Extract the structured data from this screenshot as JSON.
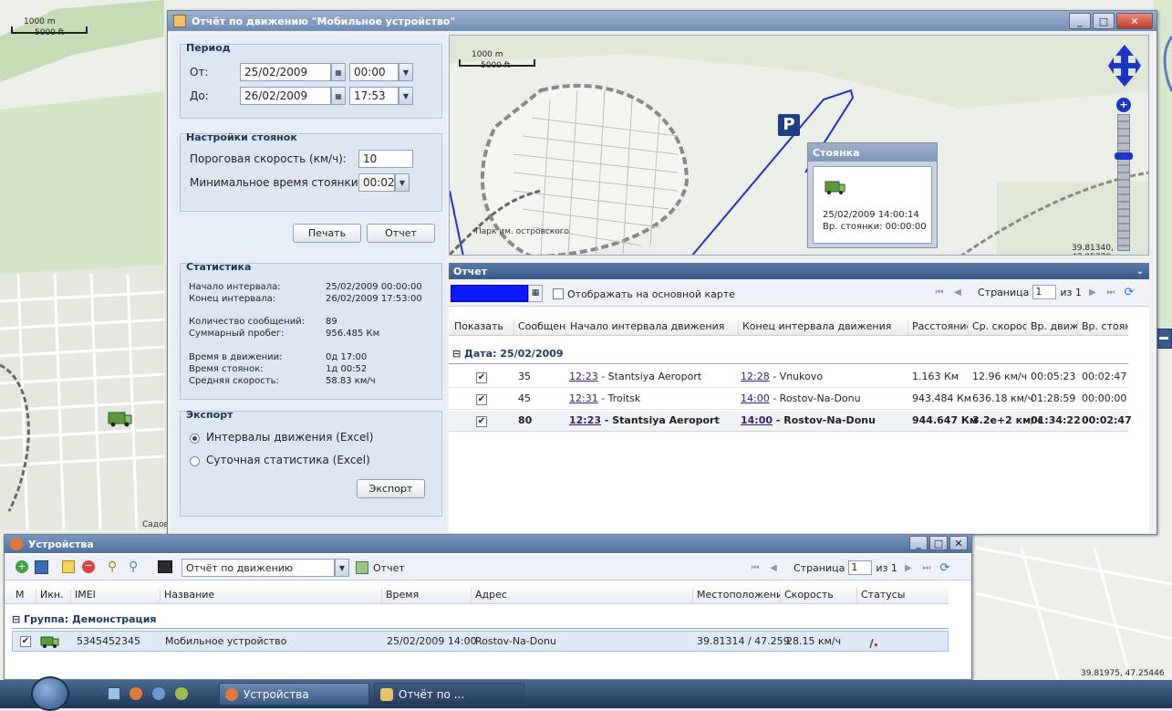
{
  "background_map": {
    "scale_m": "1000 m",
    "scale_ft": "5000 ft",
    "label_sadov": "Садов",
    "coords": "39.81975, 47.25446"
  },
  "report_window": {
    "title": "Отчёт по движению \"Мобильное устройство\"",
    "period": {
      "legend": "Период",
      "from_label": "От:",
      "from_date": "25/02/2009",
      "from_time": "00:00",
      "to_label": "До:",
      "to_date": "26/02/2009",
      "to_time": "17:53"
    },
    "stop_settings": {
      "legend": "Настройки стоянок",
      "speed_label": "Пороговая скорость (км/ч):",
      "speed_value": "10",
      "min_time_label": "Минимальное время стоянки:",
      "min_time_value": "00:02"
    },
    "buttons": {
      "print": "Печать",
      "report": "Отчет"
    },
    "statistics": {
      "legend": "Статистика",
      "rows": [
        {
          "label": "Начало интервала:",
          "value": "25/02/2009 00:00:00"
        },
        {
          "label": "Конец интервала:",
          "value": "26/02/2009 17:53:00"
        },
        {
          "label": "Количество сообщений:",
          "value": "89"
        },
        {
          "label": "Суммарный пробег:",
          "value": "956.485 Км"
        },
        {
          "label": "Время в движении:",
          "value": "0д 17:00"
        },
        {
          "label": "Время стоянок:",
          "value": "1д 00:52"
        },
        {
          "label": "Средняя скорость:",
          "value": "58.83 км/ч"
        }
      ]
    },
    "export": {
      "legend": "Экспорт",
      "option1": "Интервалы движения (Excel)",
      "option2": "Суточная статистика (Excel)",
      "button": "Экспорт"
    },
    "map": {
      "scale_m": "1000 m",
      "scale_ft": "5000 ft",
      "park_label": "Парк им. островского",
      "coords": "39.81340, 47.25778",
      "parking_marker": "P",
      "popup": {
        "title": "Стоянка",
        "time": "25/02/2009 14:00:14",
        "stop_time": "Вр. стоянки: 00:00:00"
      }
    },
    "report_panel": {
      "title": "Отчет",
      "show_on_map_label": "Отображать на основной карте",
      "page_label": "Страница",
      "page_value": "1",
      "page_of": "из 1",
      "columns": [
        "Показать",
        "Сообщени",
        "Начало интервала движения",
        "Конец интервала движения",
        "Расстояние",
        "Ср. скорост",
        "Вр. движе",
        "Вр. стоян"
      ],
      "group": "Дата: 25/02/2009",
      "rows": [
        {
          "msgs": "35",
          "start_time": "12:23",
          "start_place": " - Stantsiya Aeroport",
          "end_time": "12:28",
          "end_place": " - Vnukovo",
          "dist": "1.163 Км",
          "speed": "12.96 км/ч",
          "move": "00:05:23",
          "stop": "00:02:47"
        },
        {
          "msgs": "45",
          "start_time": "12:31",
          "start_place": " - Troitsk",
          "end_time": "14:00",
          "end_place": " - Rostov-Na-Donu",
          "dist": "943.484 Км",
          "speed": "636.18 км/ч",
          "move": "01:28:59",
          "stop": "00:00:00"
        },
        {
          "msgs": "80",
          "start_time": "12:23",
          "start_place": " - Stantsiya Aeroport",
          "end_time": "14:00",
          "end_place": " - Rostov-Na-Donu",
          "dist": "944.647 Км",
          "speed": "3.2e+2 км/ч",
          "move": "01:34:22",
          "stop": "00:02:47"
        }
      ]
    }
  },
  "devices_window": {
    "title": "Устройства",
    "toolbar": {
      "report_select": "Отчёт по движению",
      "report_button": "Отчет",
      "page_label": "Страница",
      "page_value": "1",
      "page_of": "из 1"
    },
    "columns": [
      "М",
      "Икн.",
      "IMEI",
      "Название",
      "Время",
      "Адрес",
      "Местоположение",
      "Скорость",
      "Статусы"
    ],
    "group": "Группа: Демонстрация",
    "row": {
      "imei": "5345452345",
      "name": "Мобильное устройство",
      "time": "25/02/2009 14:00:1",
      "address": "Rostov-Na-Donu",
      "location": "39.81314 / 47.259",
      "speed": "28.15 км/ч"
    }
  },
  "taskbar": {
    "task1": "Устройства",
    "task2": "Отчёт по ..."
  }
}
